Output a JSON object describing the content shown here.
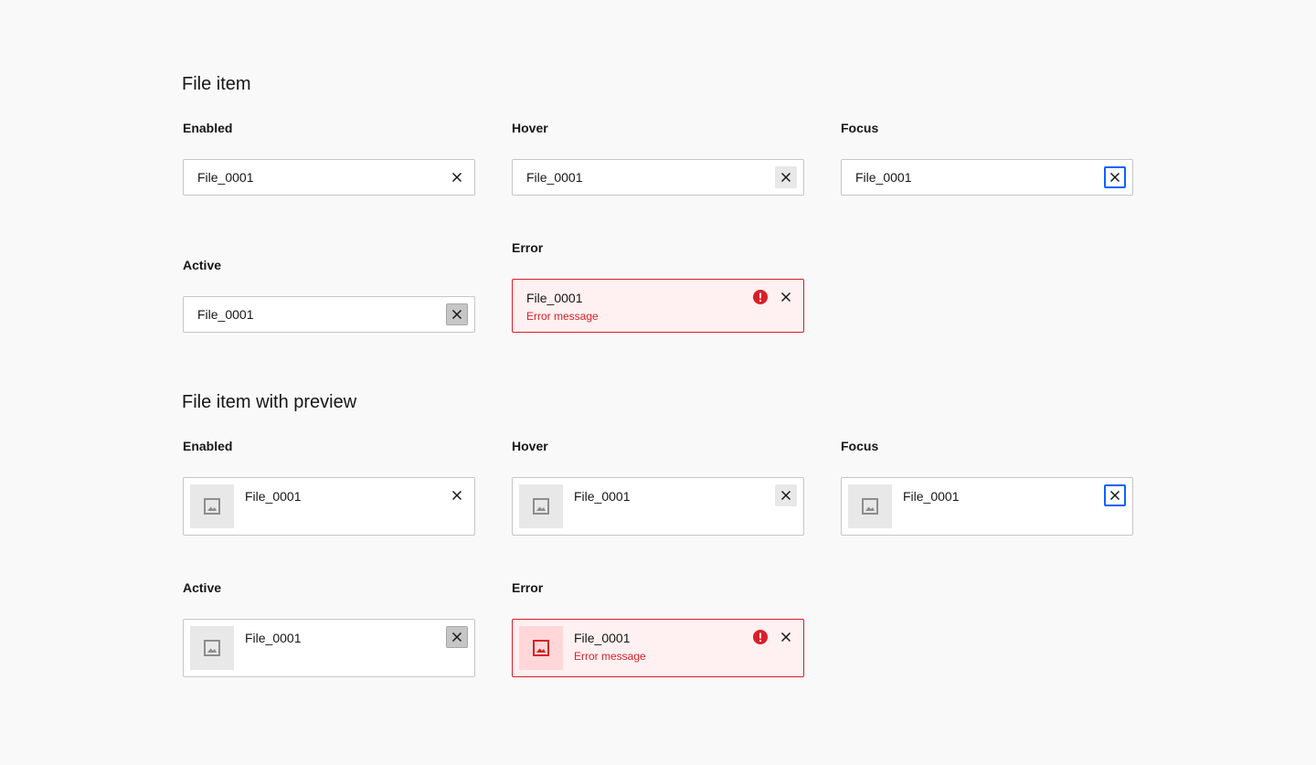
{
  "section1": {
    "title": "File item",
    "enabled": {
      "label": "Enabled",
      "file": "File_0001"
    },
    "hover": {
      "label": "Hover",
      "file": "File_0001"
    },
    "focus": {
      "label": "Focus",
      "file": "File_0001"
    },
    "active": {
      "label": "Active",
      "file": "File_0001"
    },
    "error": {
      "label": "Error",
      "file": "File_0001",
      "message": "Error message"
    }
  },
  "section2": {
    "title": "File item with preview",
    "enabled": {
      "label": "Enabled",
      "file": "File_0001"
    },
    "hover": {
      "label": "Hover",
      "file": "File_0001"
    },
    "focus": {
      "label": "Focus",
      "file": "File_0001"
    },
    "active": {
      "label": "Active",
      "file": "File_0001"
    },
    "error": {
      "label": "Error",
      "file": "File_0001",
      "message": "Error message"
    }
  },
  "icons": {
    "close": "close-icon",
    "error": "warning-filled-icon",
    "preview": "image-icon"
  },
  "colors": {
    "background": "#f9f9f9",
    "border": "#c6c6c6",
    "focus": "#0f62fe",
    "error": "#da1e28",
    "error_bg": "#fff1f1",
    "hover_bg": "#e8e8e8",
    "active_bg": "#c6c6c6"
  }
}
